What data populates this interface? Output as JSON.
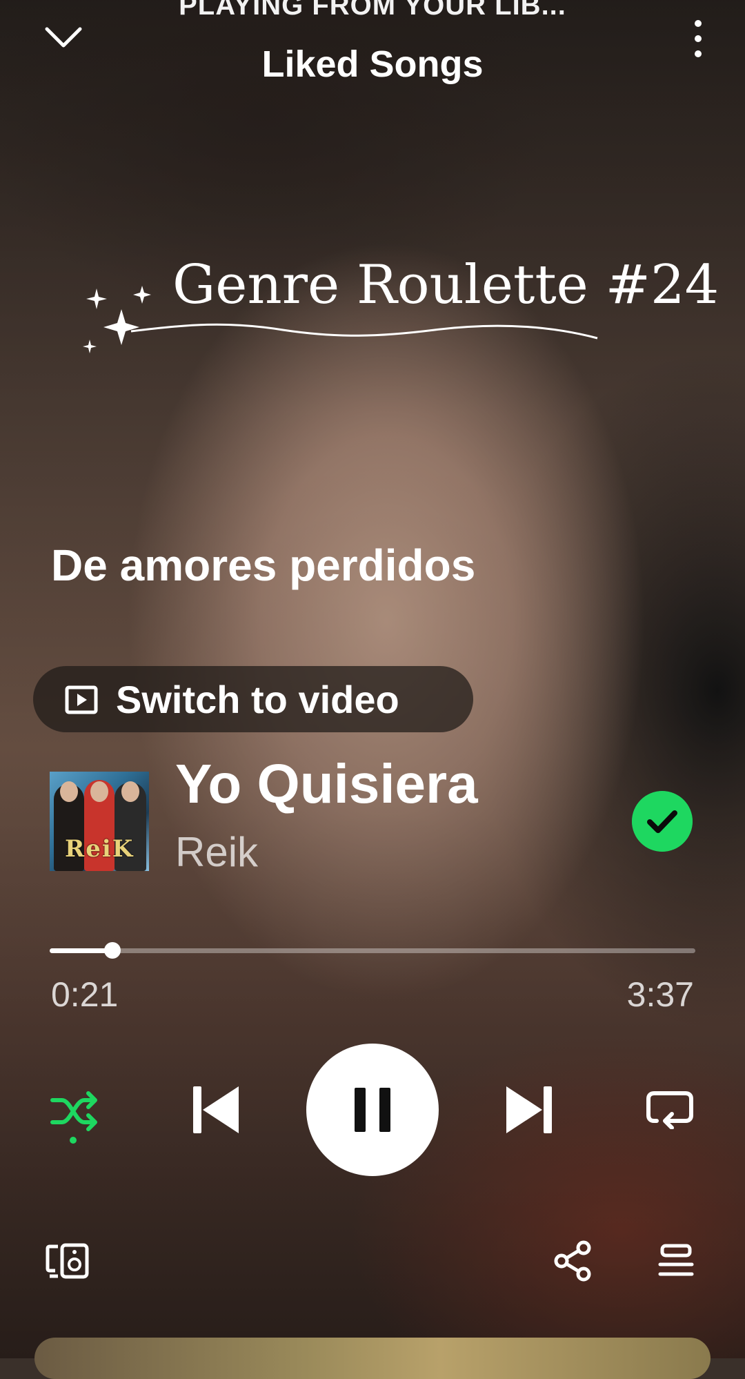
{
  "header": {
    "context": "PLAYING FROM YOUR LIB...",
    "title": "Liked Songs"
  },
  "overlay": {
    "title": "Genre Roulette #24"
  },
  "caption": "De amores perdidos",
  "switch_video": {
    "label": "Switch to video"
  },
  "track": {
    "title": "Yo Quisiera",
    "artist": "Reik",
    "cover_logo": "ReiK"
  },
  "progress": {
    "elapsed": "0:21",
    "total": "3:37",
    "fraction": 0.097
  },
  "icons": {
    "collapse": "chevron-down-icon",
    "menu": "more-vertical-icon",
    "liked": "check-circle-icon",
    "shuffle": "shuffle-icon",
    "prev": "skip-previous-icon",
    "play_pause": "pause-icon",
    "next": "skip-next-icon",
    "repeat": "repeat-icon",
    "devices": "devices-icon",
    "share": "share-icon",
    "queue": "queue-icon"
  },
  "colors": {
    "accent": "#1ed760"
  }
}
